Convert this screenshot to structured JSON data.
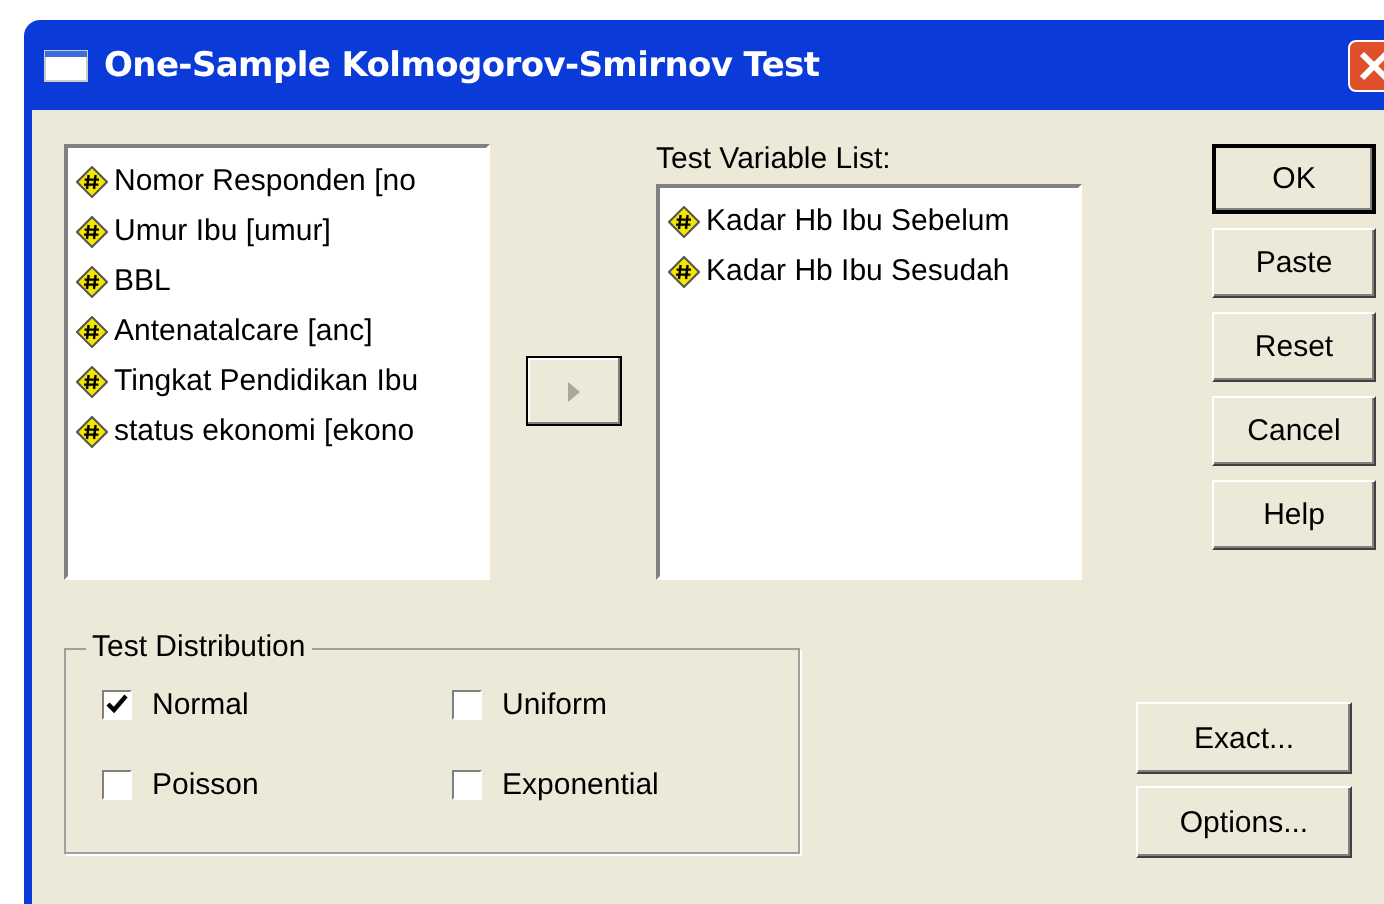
{
  "window": {
    "title": "One-Sample Kolmogorov-Smirnov Test"
  },
  "source_list": {
    "items": [
      {
        "label": "Nomor Responden [no"
      },
      {
        "label": "Umur Ibu [umur]"
      },
      {
        "label": "BBL"
      },
      {
        "label": "Antenatalcare [anc]"
      },
      {
        "label": "Tingkat Pendidikan Ibu"
      },
      {
        "label": "status ekonomi [ekono"
      }
    ]
  },
  "test_variable_list": {
    "label": "Test Variable List:",
    "items": [
      {
        "label": "Kadar Hb Ibu Sebelum"
      },
      {
        "label": "Kadar Hb Ibu Sesudah"
      }
    ]
  },
  "buttons": [
    {
      "label": "OK",
      "default": true
    },
    {
      "label": "Paste",
      "default": false
    },
    {
      "label": "Reset",
      "default": false
    },
    {
      "label": "Cancel",
      "default": false
    },
    {
      "label": "Help",
      "default": false
    }
  ],
  "test_distribution": {
    "label": "Test Distribution",
    "options": [
      {
        "label": "Normal",
        "checked": true
      },
      {
        "label": "Uniform",
        "checked": false
      },
      {
        "label": "Poisson",
        "checked": false
      },
      {
        "label": "Exponential",
        "checked": false
      }
    ]
  },
  "bottom_buttons": [
    {
      "label": "Exact..."
    },
    {
      "label": "Options..."
    }
  ]
}
